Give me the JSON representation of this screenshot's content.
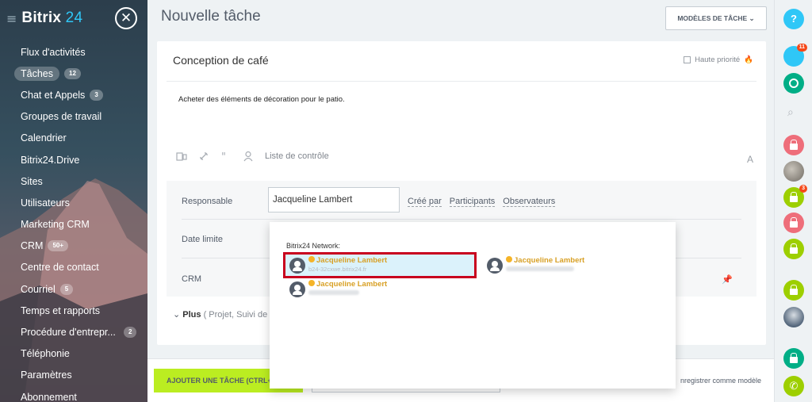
{
  "sidebar": {
    "logo_main": "Bitrix",
    "logo_suffix": "24",
    "items": [
      {
        "label": "Flux d'activités",
        "count": ""
      },
      {
        "label": "Tâches",
        "count": "12"
      },
      {
        "label": "Chat et Appels",
        "count": "3"
      },
      {
        "label": "Groupes de travail",
        "count": ""
      },
      {
        "label": "Calendrier",
        "count": ""
      },
      {
        "label": "Bitrix24.Drive",
        "count": ""
      },
      {
        "label": "Sites",
        "count": ""
      },
      {
        "label": "Utilisateurs",
        "count": ""
      },
      {
        "label": "Marketing CRM",
        "count": ""
      },
      {
        "label": "CRM",
        "count": "50+"
      },
      {
        "label": "Centre de contact",
        "count": ""
      },
      {
        "label": "Courriel",
        "count": "5"
      },
      {
        "label": "Temps et rapports",
        "count": ""
      },
      {
        "label": "Procédure d'entrepr...",
        "count": "2"
      },
      {
        "label": "Téléphonie",
        "count": ""
      },
      {
        "label": "Paramètres",
        "count": ""
      },
      {
        "label": "Abonnement",
        "count": ""
      }
    ]
  },
  "header": {
    "title": "Nouvelle tâche",
    "templates_button": "MODÈLES DE TÂCHE"
  },
  "task": {
    "title": "Conception de café",
    "priority_label": "Haute priorité",
    "description": "Acheter des éléments de décoration pour le patio.",
    "checklist_label": "Liste de contrôle",
    "font_icon": "A"
  },
  "properties": {
    "responsible_label": "Responsable",
    "responsible_value": "Jacqueline Lambert",
    "links": [
      "Créé par",
      "Participants",
      "Observateurs"
    ],
    "deadline_label": "Date limite",
    "crm_label": "CRM",
    "more_label": "Plus",
    "more_sub": "( Projet,  Suivi de"
  },
  "footer": {
    "add_button": "AJOUTER UNE TÂCHE (CTRL+ENTRÉE)",
    "save_template": "nregistrer comme modèle"
  },
  "popup": {
    "network_label": "Bitrix24 Network:",
    "results": [
      {
        "name": "Jacqueline Lambert",
        "sub": "b24-32cxwe.bitrix24.fr",
        "selected": true
      },
      {
        "name": "Jacqueline Lambert",
        "sub": "",
        "selected": false
      },
      {
        "name": "Jacqueline Lambert",
        "sub": "",
        "selected": false
      }
    ]
  },
  "rightbar": {
    "help": "?",
    "notifications_count": "11",
    "locked_count": "3"
  },
  "colors": {
    "accent_green": "#bbed21",
    "brand_blue": "#2fc7f7",
    "highlight_red": "#c8001e",
    "network_name": "#d8a025"
  }
}
